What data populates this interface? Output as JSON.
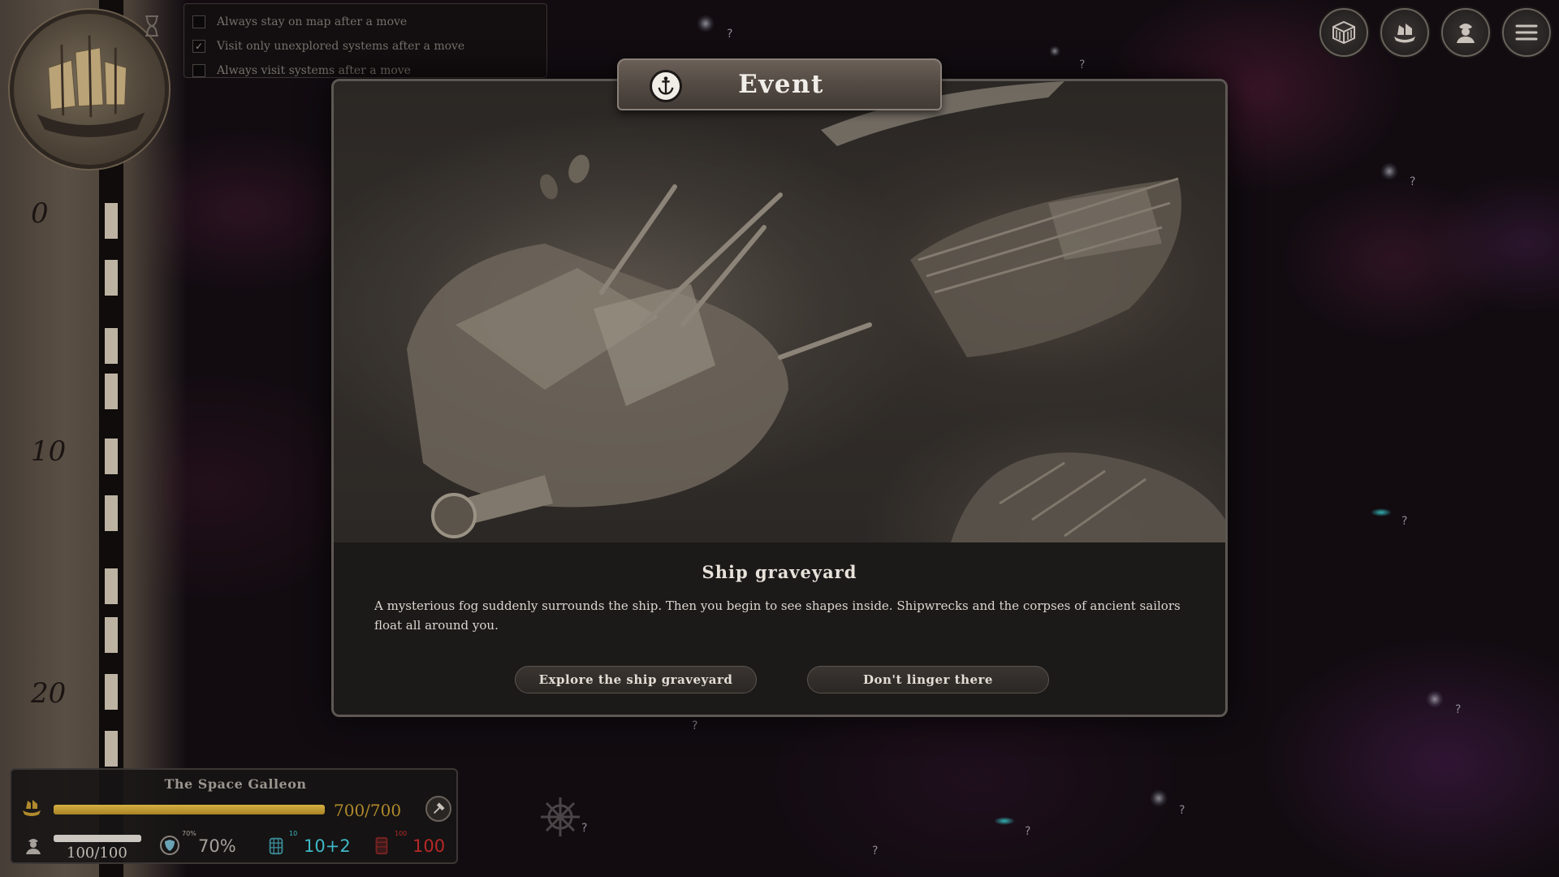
{
  "options": [
    {
      "label": "Always stay on map after a move",
      "checked": false
    },
    {
      "label": "Visit only unexplored systems after a move",
      "checked": true
    },
    {
      "label": "Always visit systems after a move",
      "checked": false
    }
  ],
  "ruler": {
    "labels": [
      "0",
      "10",
      "20"
    ]
  },
  "map_markers": {
    "unknown": "?"
  },
  "top_buttons": [
    {
      "name": "cargo-icon"
    },
    {
      "name": "ship-icon"
    },
    {
      "name": "crew-icon"
    },
    {
      "name": "menu-icon"
    }
  ],
  "event": {
    "header": "Event",
    "title": "Ship graveyard",
    "description": "A mysterious fog suddenly surrounds the ship. Then you begin to see shapes inside. Shipwrecks and the corpses of ancient sailors float all around you.",
    "choices": [
      "Explore the ship graveyard",
      "Don't linger there"
    ]
  },
  "ship": {
    "name": "The Space Galleon",
    "hull": "700/700",
    "hull_fraction": 1.0,
    "crew": "100/100",
    "crew_fraction": 1.0,
    "shield_small": "70%",
    "shield": "70%",
    "supplies_small": "10",
    "supplies": "10+2",
    "ammo_small": "100",
    "ammo": "100"
  },
  "colors": {
    "hull": "#b08a2c",
    "supplies": "#3fb8c6",
    "ammo": "#b82828",
    "shield": "#a7a19b"
  }
}
